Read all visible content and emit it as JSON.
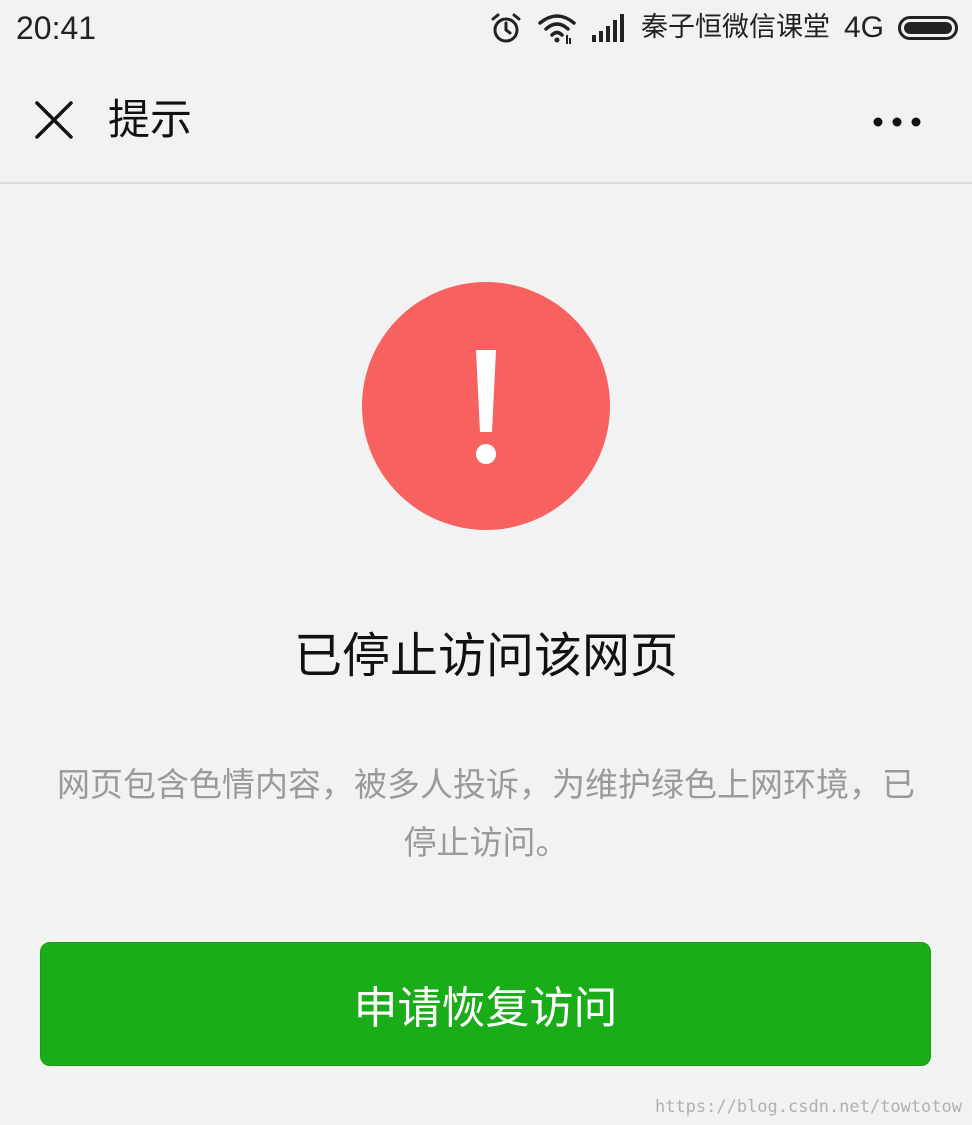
{
  "status_bar": {
    "time": "20:41",
    "carrier": "秦子恒微信课堂",
    "network": "4G",
    "icons": [
      "alarm-icon",
      "wifi-icon",
      "signal-icon",
      "battery-icon"
    ],
    "battery_level": 1.0
  },
  "nav": {
    "title": "提示",
    "close_icon": "close-icon",
    "more_icon": "more-icon"
  },
  "warning": {
    "icon": "exclamation-icon",
    "color": "#f76260"
  },
  "main": {
    "title": "已停止访问该网页",
    "description": "网页包含色情内容，被多人投诉，为维护绿色上网环境，已停止访问。"
  },
  "action": {
    "label": "申请恢复访问",
    "color": "#1aad19"
  },
  "watermark": "https://blog.csdn.net/towtotow"
}
